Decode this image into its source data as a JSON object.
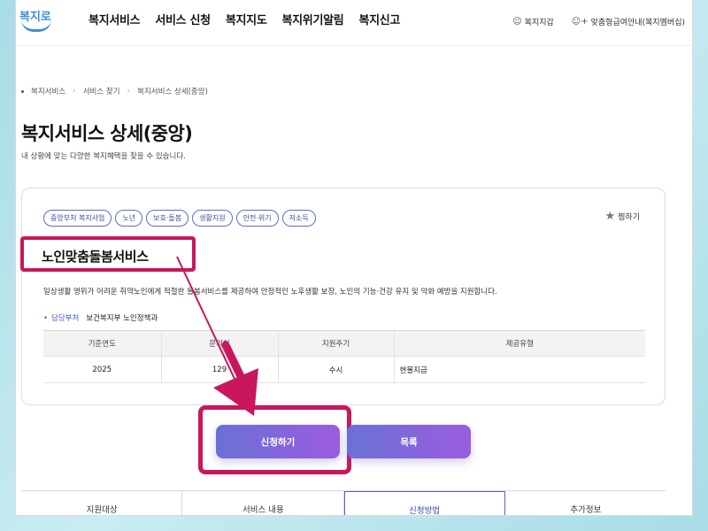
{
  "header": {
    "logo_text": "복지로",
    "nav": [
      "복지서비스",
      "서비스 신청",
      "복지지도",
      "복지위기알림",
      "복지신고"
    ],
    "util": [
      {
        "icon": "user-icon",
        "label": "복지지갑"
      },
      {
        "icon": "user-plus-icon",
        "label": "맞춤형급여안내(복지멤버십)"
      }
    ]
  },
  "breadcrumb": [
    "복지서비스",
    "서비스 찾기",
    "복지서비스 상세(중앙)"
  ],
  "page": {
    "title": "복지서비스 상세(중앙)",
    "desc": "내 상황에 맞는 다양한 복지혜택을 찾을 수 있습니다."
  },
  "card": {
    "tags": [
      "중앙부처 복지사업",
      "노년",
      "보호·돌봄",
      "생활지원",
      "안전·위기",
      "저소득"
    ],
    "fav_label": "찜하기",
    "service_name": "노인맞춤돌봄서비스",
    "summary": "일상생활 영위가 어려운 취약노인에게 적절한 돌봄서비스를 제공하여 안정적인 노후생활 보장, 노인의 기능·건강 유지 및 악화 예방을 지원합니다.",
    "dept_label": "담당부처",
    "dept_value": "보건복지부 노인정책과",
    "table": {
      "headers": [
        "기준연도",
        "문의처",
        "지원주기",
        "제공유형"
      ],
      "row": [
        "2025",
        "129",
        "수시",
        "현물지급"
      ]
    }
  },
  "buttons": {
    "apply": "신청하기",
    "list": "목록"
  },
  "tabs": [
    "지원대상",
    "서비스 내용",
    "신청방법",
    "추가정보"
  ],
  "active_tab": "신청방법",
  "colors": {
    "accent": "#5a65c8",
    "highlight": "#c8175d",
    "button_gradient_start": "#6a71d6",
    "button_gradient_end": "#9b5be0"
  }
}
